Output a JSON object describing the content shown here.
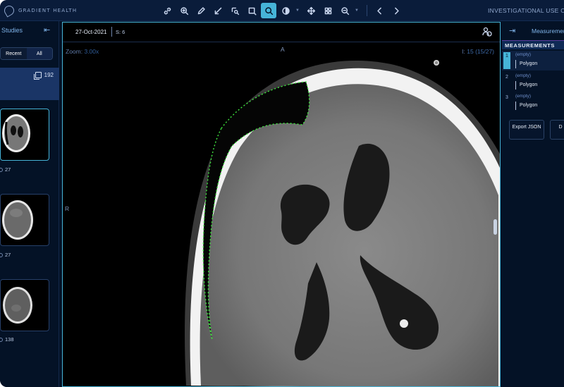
{
  "header": {
    "brand": "GRADIENT HEALTH",
    "notice": "INVESTIGATIONAL USE O",
    "tools": [
      {
        "icon": "link-icon"
      },
      {
        "icon": "zoom-in-icon"
      },
      {
        "icon": "pencil-icon"
      },
      {
        "icon": "arrow-annotate-icon"
      },
      {
        "icon": "magnify-region-icon"
      },
      {
        "icon": "crop-icon"
      },
      {
        "icon": "zoom-icon",
        "active": true
      },
      {
        "icon": "contrast-icon"
      },
      {
        "icon": "pan-icon"
      },
      {
        "icon": "layout-icon"
      },
      {
        "icon": "zoom-out-icon"
      },
      {
        "icon": "chevron-left-icon"
      },
      {
        "icon": "chevron-right-icon"
      }
    ]
  },
  "left_panel": {
    "title": "Studies",
    "tabs": [
      "Recent",
      "All"
    ],
    "study_image_count": "192",
    "series": [
      {
        "count": "27",
        "selected": true
      },
      {
        "count": "27",
        "selected": false
      },
      {
        "count": "138",
        "selected": false
      }
    ]
  },
  "viewport": {
    "date": "27-Oct-2021",
    "series": "S: 6",
    "zoom_label": "Zoom:",
    "zoom_value": "3.00x",
    "instance_label": "I:",
    "instance_value": "15 (15/27)",
    "orientation_top": "A",
    "orientation_left": "R"
  },
  "right_panel": {
    "title": "Measurements",
    "section": "MEASUREMENTS",
    "items": [
      {
        "index": "1",
        "label": "(empty)",
        "type": "Polygon",
        "selected": true
      },
      {
        "index": "2",
        "label": "(empty)",
        "type": "Polygon",
        "selected": false
      },
      {
        "index": "3",
        "label": "(empty)",
        "type": "Polygon",
        "selected": false
      }
    ],
    "export_button": "Export JSON",
    "second_button": "D"
  },
  "colors": {
    "accent": "#46b4d8",
    "background": "#041226",
    "annotation": "#3ee63e"
  }
}
